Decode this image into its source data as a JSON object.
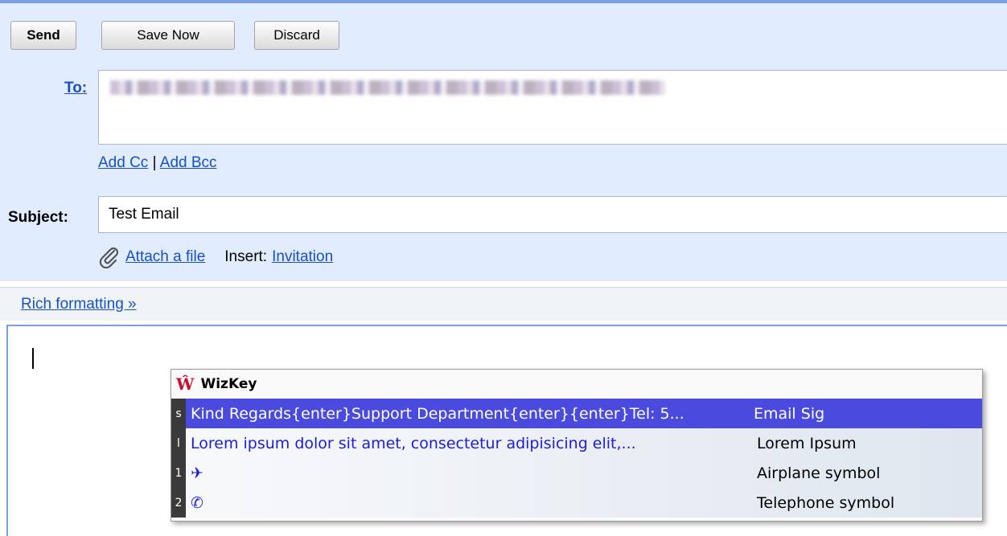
{
  "toolbar": {
    "send_label": "Send",
    "save_label": "Save Now",
    "discard_label": "Discard"
  },
  "to": {
    "label": "To:"
  },
  "add_links": {
    "cc": "Add Cc",
    "separator": " | ",
    "bcc": "Add Bcc"
  },
  "subject": {
    "label": "Subject:",
    "value": "Test Email"
  },
  "attach": {
    "attach_label": "Attach a file",
    "insert_label": "Insert:",
    "invitation_label": "Invitation"
  },
  "rich_formatting": "Rich formatting »",
  "wizkey": {
    "title": "WizKey",
    "items": [
      {
        "key": "s",
        "text": "Kind Regards{enter}Support Department{enter}{enter}Tel: 5...",
        "desc": "Email Sig"
      },
      {
        "key": "l",
        "text": "Lorem ipsum dolor sit amet, consectetur adipisicing elit,...",
        "desc": "Lorem Ipsum"
      },
      {
        "key": "1",
        "text": "✈",
        "desc": "Airplane symbol"
      },
      {
        "key": "2",
        "text": "✆",
        "desc": "Telephone symbol"
      }
    ]
  },
  "colors": {
    "accent": "#7b9ee3",
    "link": "#1750c6",
    "compose_bg": "#e1ecfe",
    "selected_row": "#4a4adf"
  }
}
